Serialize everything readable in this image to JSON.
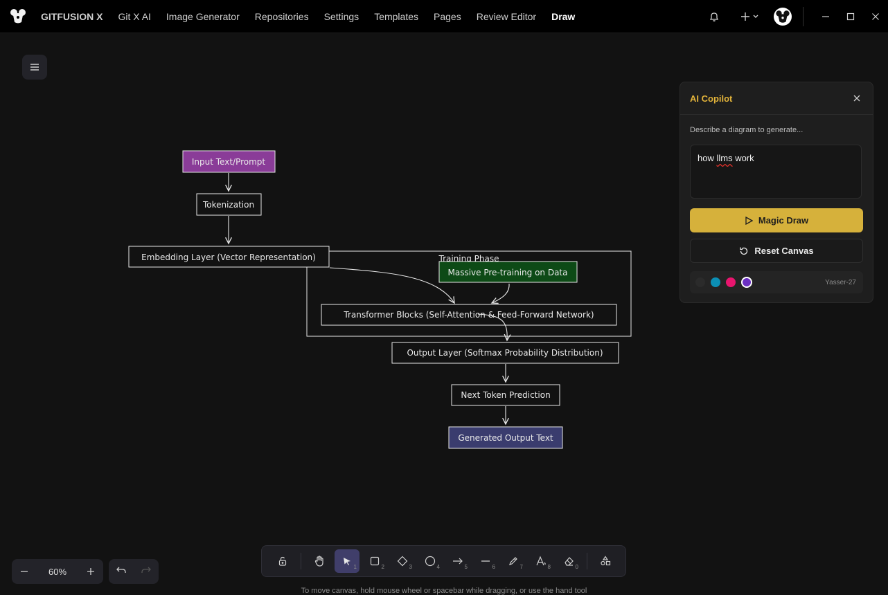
{
  "header": {
    "nav": [
      "GITFUSION X",
      "Git X AI",
      "Image Generator",
      "Repositories",
      "Settings",
      "Templates",
      "Pages",
      "Review Editor",
      "Draw"
    ],
    "active": "Draw"
  },
  "diagram": {
    "group_label": "Training Phase",
    "nodes": {
      "input": "Input Text/Prompt",
      "tokenization": "Tokenization",
      "embedding": "Embedding Layer (Vector Representation)",
      "pretraining": "Massive Pre-training on Data",
      "transformer": "Transformer Blocks (Self-Attention & Feed-Forward Network)",
      "output_layer": "Output Layer (Softmax Probability Distribution)",
      "next_token": "Next Token Prediction",
      "generated": "Generated Output Text"
    },
    "colors": {
      "input": "#8a3c98",
      "pretraining": "#0d4a16",
      "generated": "#3a3c6e",
      "stroke": "#e8e8e8"
    }
  },
  "copilot": {
    "title": "AI Copilot",
    "label": "Describe a diagram to generate...",
    "prompt": "how llms work",
    "magic_label": "Magic Draw",
    "reset_label": "Reset Canvas",
    "user": "Yasser-27",
    "swatches": [
      "#2b2b2b",
      "#0c8fb5",
      "#e8156e",
      "#6b2fc2"
    ]
  },
  "zoom": {
    "value": "60%"
  },
  "toolbar": {
    "tools": [
      {
        "name": "lock",
        "num": ""
      },
      {
        "name": "hand",
        "num": ""
      },
      {
        "name": "select",
        "num": "1"
      },
      {
        "name": "rectangle",
        "num": "2"
      },
      {
        "name": "diamond",
        "num": "3"
      },
      {
        "name": "ellipse",
        "num": "4"
      },
      {
        "name": "arrow",
        "num": "5"
      },
      {
        "name": "line",
        "num": "6"
      },
      {
        "name": "pencil",
        "num": "7"
      },
      {
        "name": "text",
        "num": "8"
      },
      {
        "name": "eraser",
        "num": "0"
      },
      {
        "name": "shapes",
        "num": ""
      }
    ],
    "hint": "To move canvas, hold mouse wheel or spacebar while dragging, or use the hand tool"
  }
}
